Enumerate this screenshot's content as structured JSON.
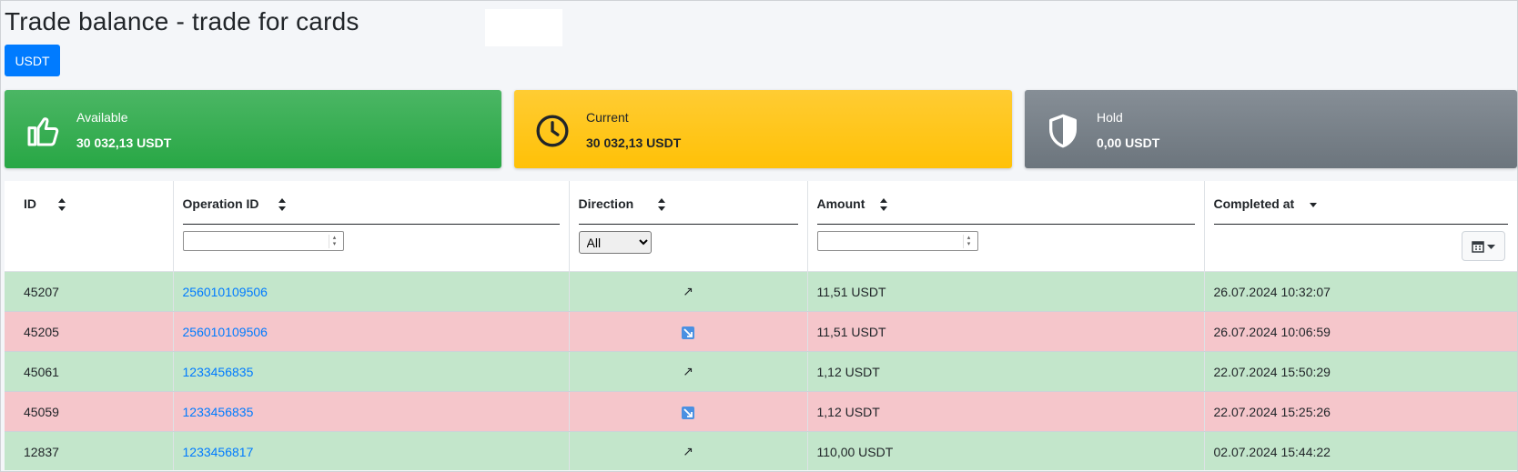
{
  "page": {
    "title": "Trade balance - trade for cards"
  },
  "currency_button": {
    "label": "USDT"
  },
  "info_boxes": [
    {
      "label": "Available",
      "value": "30 032,13 USDT",
      "icon": "thumbs-up-icon",
      "color": "#28a745"
    },
    {
      "label": "Current",
      "value": "30 032,13 USDT",
      "icon": "clock-icon",
      "color": "#ffc107"
    },
    {
      "label": "Hold",
      "value": "0,00 USDT",
      "icon": "shield-icon",
      "color": "#6c757d"
    }
  ],
  "table": {
    "columns": [
      {
        "label": "ID",
        "sort": "both"
      },
      {
        "label": "Operation ID",
        "sort": "both"
      },
      {
        "label": "Direction",
        "sort": "both"
      },
      {
        "label": "Amount",
        "sort": "both"
      },
      {
        "label": "Completed at",
        "sort": "desc"
      }
    ],
    "filters": {
      "operation_id": {
        "value": "",
        "placeholder": ""
      },
      "direction": {
        "selected": "All"
      },
      "amount": {
        "value": "",
        "placeholder": ""
      }
    },
    "rows": [
      {
        "id": "45207",
        "operation_id": "256010109506",
        "direction": "in",
        "direction_glyph": "↗",
        "amount": "11,51 USDT",
        "completed_at": "26.07.2024 10:32:07"
      },
      {
        "id": "45205",
        "operation_id": "256010109506",
        "direction": "out",
        "direction_glyph": "↘",
        "amount": "11,51 USDT",
        "completed_at": "26.07.2024 10:06:59"
      },
      {
        "id": "45061",
        "operation_id": "1233456835",
        "direction": "in",
        "direction_glyph": "↗",
        "amount": "1,12 USDT",
        "completed_at": "22.07.2024 15:50:29"
      },
      {
        "id": "45059",
        "operation_id": "1233456835",
        "direction": "out",
        "direction_glyph": "↘",
        "amount": "1,12 USDT",
        "completed_at": "22.07.2024 15:25:26"
      },
      {
        "id": "12837",
        "operation_id": "1233456817",
        "direction": "in",
        "direction_glyph": "↗",
        "amount": "110,00 USDT",
        "completed_at": "02.07.2024 15:44:22"
      }
    ],
    "row_colors": {
      "in": "#c3e6cb",
      "out": "#f5c6cb"
    }
  }
}
